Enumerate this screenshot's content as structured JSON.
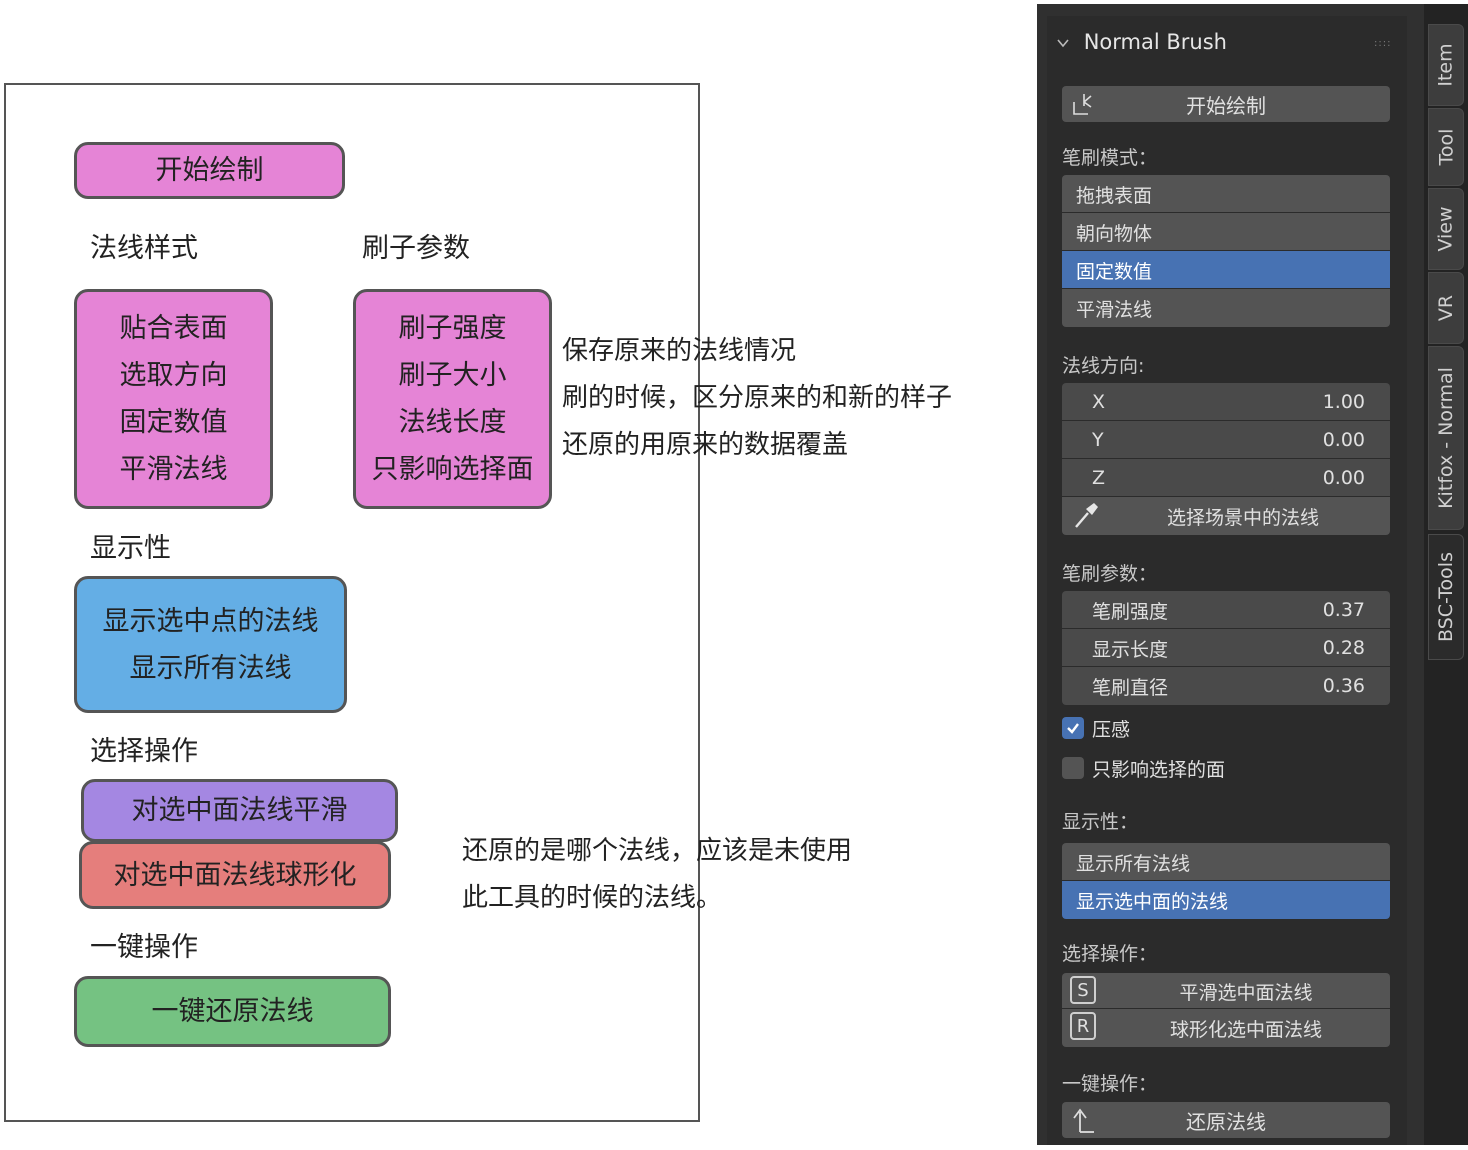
{
  "sketch": {
    "start_button": "开始绘制",
    "normal_style_label": "法线样式",
    "brush_params_label": "刷子参数",
    "normal_style_items": [
      "贴合表面",
      "选取方向",
      "固定数值",
      "平滑法线"
    ],
    "brush_param_items": [
      "刷子强度",
      "刷子大小",
      "法线长度",
      "只影响选择面"
    ],
    "note1": [
      "保存原来的法线情况",
      "刷的时候，区分原来的和新的样子",
      "还原的用原来的数据覆盖"
    ],
    "display_label": "显示性",
    "display_items": [
      "显示选中点的法线",
      "显示所有法线"
    ],
    "select_ops_label": "选择操作",
    "smooth_button": "对选中面法线平滑",
    "spherize_button": "对选中面法线球形化",
    "note2": [
      "还原的是哪个法线，应该是未使用",
      "此工具的时候的法线。"
    ],
    "one_click_label": "一键操作",
    "restore_button": "一键还原法线",
    "colors": {
      "pink": "#e584d6",
      "blue": "#64aee5",
      "purple": "#a487e2",
      "red": "#e57e7c",
      "green": "#75c282"
    }
  },
  "panel": {
    "title": "Normal Brush",
    "start_draw": "开始绘制",
    "brush_mode_label": "笔刷模式：",
    "brush_modes": [
      "拖拽表面",
      "朝向物体",
      "固定数值",
      "平滑法线"
    ],
    "brush_mode_selected": 2,
    "normal_dir_label": "法线方向:",
    "axes": [
      {
        "name": "X",
        "value": "1.00"
      },
      {
        "name": "Y",
        "value": "0.00"
      },
      {
        "name": "Z",
        "value": "0.00"
      }
    ],
    "pick_normal": "选择场景中的法线",
    "brush_params_label": "笔刷参数：",
    "params": [
      {
        "name": "笔刷强度",
        "value": "0.37"
      },
      {
        "name": "显示长度",
        "value": "0.28"
      },
      {
        "name": "笔刷直径",
        "value": "0.36"
      }
    ],
    "pressure_label": "压感",
    "pressure_checked": true,
    "affect_selected_label": "只影响选择的面",
    "affect_selected_checked": false,
    "display_label": "显示性：",
    "display_options": [
      "显示所有法线",
      "显示选中面的法线"
    ],
    "display_selected": 1,
    "select_ops_label": "选择操作：",
    "smooth_key": "S",
    "smooth_button": "平滑选中面法线",
    "spherize_key": "R",
    "spherize_button": "球形化选中面法线",
    "one_click_label": "一键操作：",
    "restore_button": "还原法线",
    "tabs": [
      "Item",
      "Tool",
      "View",
      "VR",
      "Kitfox - Normal",
      "BSC-Tools"
    ],
    "accent": "#4772b3"
  }
}
